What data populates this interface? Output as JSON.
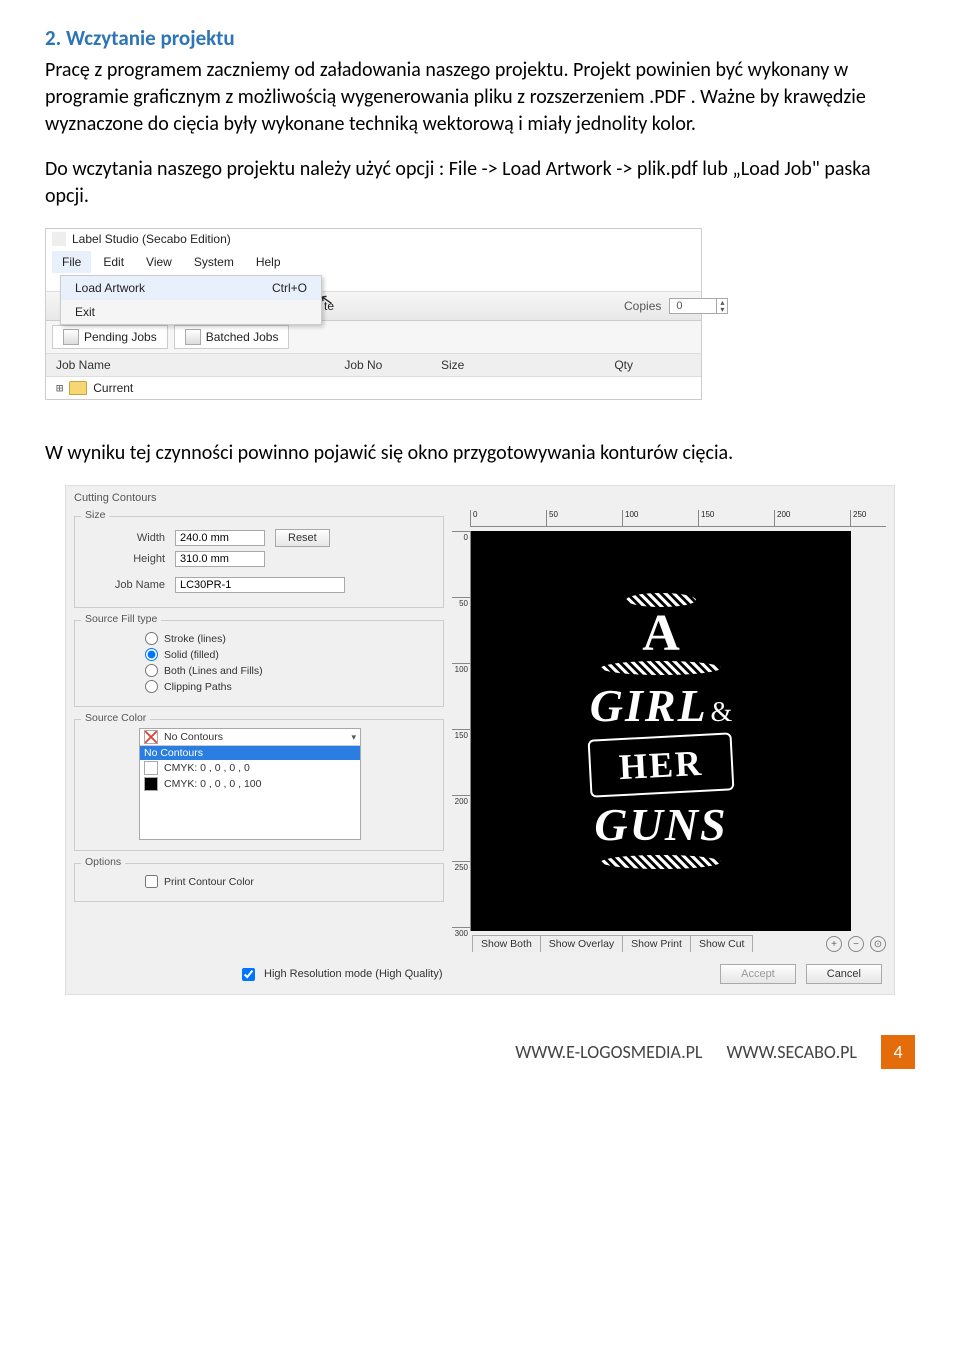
{
  "doc": {
    "heading": "2.  Wczytanie projektu",
    "para1": "Pracę z programem zaczniemy od załadowania naszego projektu. Projekt powinien być wykonany w programie graficznym z możliwością wygenerowania pliku z rozszerzeniem .PDF . Ważne by krawędzie wyznaczone do cięcia były wykonane techniką wektorową i miały jednolity kolor.",
    "para2": "Do wczytania naszego projektu należy użyć opcji :  File -> Load Artwork  -> plik.pdf lub „Load Job\" paska opcji.",
    "para3": "W wyniku tej czynności powinno pojawić się okno przygotowywania konturów cięcia."
  },
  "ss1": {
    "title": "Label Studio (Secabo Edition)",
    "menu": {
      "file": "File",
      "edit": "Edit",
      "view": "View",
      "system": "System",
      "help": "Help"
    },
    "dropdown": {
      "load": "Load Artwork",
      "loadShortcut": "Ctrl+O",
      "exit": "Exit"
    },
    "toolbar": {
      "teLabel": "te",
      "copiesLabel": "Copies",
      "copiesVal": "0"
    },
    "tabs": {
      "pending": "Pending Jobs",
      "batched": "Batched Jobs"
    },
    "cols": {
      "name": "Job Name",
      "no": "Job No",
      "size": "Size",
      "qty": "Qty"
    },
    "tree": {
      "current": "Current"
    }
  },
  "ss2": {
    "title": "Cutting Contours",
    "size": {
      "label": "Size",
      "widthLabel": "Width",
      "widthVal": "240.0 mm",
      "heightLabel": "Height",
      "heightVal": "310.0 mm",
      "jobNameLabel": "Job Name",
      "jobNameVal": "LC30PR-1",
      "reset": "Reset"
    },
    "fill": {
      "label": "Source Fill type",
      "stroke": "Stroke (lines)",
      "solid": "Solid (filled)",
      "both": "Both (Lines and Fills)",
      "clip": "Clipping Paths"
    },
    "color": {
      "label": "Source Color",
      "hdr": "No Contours",
      "sel": "No Contours",
      "c1": "CMYK: 0 , 0 , 0 , 0",
      "c2": "CMYK: 0 , 0 , 0 , 100"
    },
    "options": {
      "label": "Options",
      "printContour": "Print Contour Color"
    },
    "ruler_h": [
      "0",
      "50",
      "100",
      "150",
      "200",
      "250"
    ],
    "ruler_v": [
      "0",
      "50",
      "100",
      "150",
      "200",
      "250",
      "300"
    ],
    "art": {
      "l1": "A",
      "l2": "GIRL",
      "amp": "&",
      "l3": "HER",
      "l4": "GUNS"
    },
    "tabs": {
      "both": "Show Both",
      "overlay": "Show Overlay",
      "print": "Show Print",
      "cut": "Show Cut"
    },
    "footer": {
      "hires": "High Resolution mode (High Quality)",
      "accept": "Accept",
      "cancel": "Cancel"
    }
  },
  "footer": {
    "u1": "WWW.E-LOGOSMEDIA.PL",
    "u2": "WWW.SECABO.PL",
    "page": "4"
  }
}
